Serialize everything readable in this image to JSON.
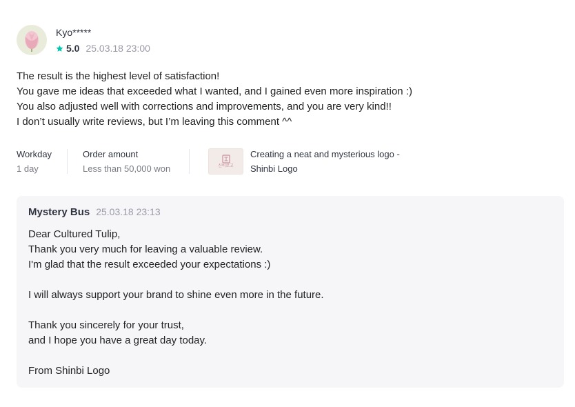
{
  "review": {
    "nickname": "Kyo*****",
    "rating": "5.0",
    "date": "25.03.18 23:00",
    "lines": [
      "The result is the highest level of satisfaction!",
      "You gave me ideas that exceeded what I wanted, and I gained even more inspiration :)",
      "You also adjusted well with corrections and improvements, and you are very kind!!",
      "I don’t usually write reviews, but I’m leaving this comment ^^"
    ],
    "meta": {
      "workday_label": "Workday",
      "workday_value": "1 day",
      "order_label": "Order amount",
      "order_value": "Less than 50,000 won",
      "gig_title_line1": "Creating a neat and mysterious logo -",
      "gig_title_line2": "Shinbi Logo",
      "gig_thumb_text": "신비로고"
    }
  },
  "reply": {
    "seller": "Mystery Bus",
    "date": "25.03.18 23:13",
    "lines": [
      "Dear Cultured Tulip,",
      "Thank you very much for leaving a valuable review.",
      "I'm glad that the result exceeded your expectations :)",
      "",
      "I will always support your brand to shine even more in the future.",
      "",
      "Thank you sincerely for your trust,",
      "and I hope you have a great day today.",
      "",
      "From Shinbi Logo"
    ]
  },
  "colors": {
    "star": "#00c7ae",
    "reply_bg": "#f6f6f9",
    "avatar_bg": "#e9ecda",
    "tulip": "#e8a9b8"
  },
  "icons": {
    "avatar": "tulip-icon",
    "rating": "star-icon"
  }
}
